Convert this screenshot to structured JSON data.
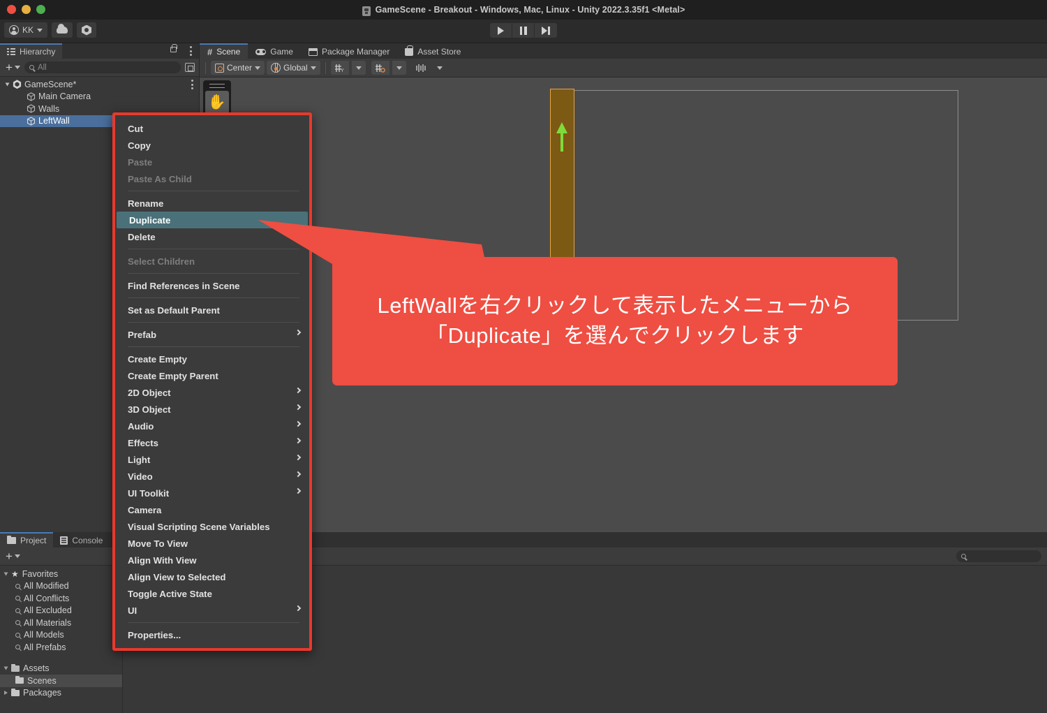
{
  "window": {
    "title": "GameScene - Breakout - Windows, Mac, Linux - Unity 2022.3.35f1 <Metal>",
    "app_icon": "unity-icon"
  },
  "toolbar": {
    "account_label": "KK",
    "cloud_icon": "cloud-icon",
    "settings_icon": "services-hex-icon",
    "play_icon": "play-icon",
    "pause_icon": "pause-icon",
    "step_icon": "step-icon"
  },
  "hierarchy": {
    "tab_label": "Hierarchy",
    "lock_icon": "lock-icon",
    "menu_icon": "kebab-menu-icon",
    "add_label": "+",
    "search_placeholder": "All",
    "search_value": "",
    "items": [
      {
        "label": "GameScene*",
        "icon": "unity-scene-icon",
        "indent": 0,
        "selected": false,
        "expanded": true
      },
      {
        "label": "Main Camera",
        "icon": "gameobject-cube-icon",
        "indent": 1,
        "selected": false
      },
      {
        "label": "Walls",
        "icon": "gameobject-cube-icon",
        "indent": 1,
        "selected": false
      },
      {
        "label": "LeftWall",
        "icon": "gameobject-cube-icon",
        "indent": 1,
        "selected": true
      }
    ]
  },
  "main_tabs": [
    {
      "label": "Scene",
      "icon": "scene-hash-icon",
      "active": true
    },
    {
      "label": "Game",
      "icon": "game-controller-icon",
      "active": false
    },
    {
      "label": "Package Manager",
      "icon": "package-icon",
      "active": false
    },
    {
      "label": "Asset Store",
      "icon": "store-bag-icon",
      "active": false
    }
  ],
  "scene_toolbar": {
    "pivot_label": "Center",
    "handle_label": "Global",
    "grid_icon": "grid-snap-icon",
    "snap_icon": "snap-increment-icon",
    "ruler_icon": "grid-ruler-icon"
  },
  "scene_view": {
    "hand_tool_icon": "hand-tool-icon",
    "selected_object": "LeftWall",
    "gizmo_arrow": "move-up-arrow-gizmo",
    "wall_color": "#7d5a14",
    "wall_outline_color": "#e8a33f",
    "gizmo_color": "#7fdb3a",
    "background_color": "#4b4b4b"
  },
  "context_menu": {
    "highlight_color": "#4a7179",
    "border_color": "#e8392c",
    "items": [
      {
        "label": "Cut",
        "enabled": true,
        "submenu": false
      },
      {
        "label": "Copy",
        "enabled": true,
        "submenu": false
      },
      {
        "label": "Paste",
        "enabled": false,
        "submenu": false
      },
      {
        "label": "Paste As Child",
        "enabled": false,
        "submenu": false
      },
      {
        "separator": true
      },
      {
        "label": "Rename",
        "enabled": true,
        "submenu": false
      },
      {
        "label": "Duplicate",
        "enabled": true,
        "submenu": false,
        "highlighted": true
      },
      {
        "label": "Delete",
        "enabled": true,
        "submenu": false
      },
      {
        "separator": true
      },
      {
        "label": "Select Children",
        "enabled": false,
        "submenu": false
      },
      {
        "separator": true
      },
      {
        "label": "Find References in Scene",
        "enabled": true,
        "submenu": false
      },
      {
        "separator": true
      },
      {
        "label": "Set as Default Parent",
        "enabled": true,
        "submenu": false
      },
      {
        "separator": true
      },
      {
        "label": "Prefab",
        "enabled": true,
        "submenu": true
      },
      {
        "separator": true
      },
      {
        "label": "Create Empty",
        "enabled": true,
        "submenu": false
      },
      {
        "label": "Create Empty Parent",
        "enabled": true,
        "submenu": false
      },
      {
        "label": "2D Object",
        "enabled": true,
        "submenu": true
      },
      {
        "label": "3D Object",
        "enabled": true,
        "submenu": true
      },
      {
        "label": "Audio",
        "enabled": true,
        "submenu": true
      },
      {
        "label": "Effects",
        "enabled": true,
        "submenu": true
      },
      {
        "label": "Light",
        "enabled": true,
        "submenu": true
      },
      {
        "label": "Video",
        "enabled": true,
        "submenu": true
      },
      {
        "label": "UI Toolkit",
        "enabled": true,
        "submenu": true
      },
      {
        "label": "Camera",
        "enabled": true,
        "submenu": false
      },
      {
        "label": "Visual Scripting Scene Variables",
        "enabled": true,
        "submenu": false
      },
      {
        "label": "Move To View",
        "enabled": true,
        "submenu": false
      },
      {
        "label": "Align With View",
        "enabled": true,
        "submenu": false
      },
      {
        "label": "Align View to Selected",
        "enabled": true,
        "submenu": false
      },
      {
        "label": "Toggle Active State",
        "enabled": true,
        "submenu": false
      },
      {
        "label": "UI",
        "enabled": true,
        "submenu": true
      },
      {
        "separator": true
      },
      {
        "label": "Properties...",
        "enabled": true,
        "submenu": false
      }
    ]
  },
  "annotation": {
    "line1": "LeftWallを右クリックして表示したメニューから",
    "line2": "「Duplicate」を選んでクリックします",
    "background_color": "#ef4e42",
    "text_color": "#ffffff"
  },
  "project_panel": {
    "tabs": [
      {
        "label": "Project",
        "icon": "folder-icon",
        "active": true
      },
      {
        "label": "Console",
        "icon": "console-icon",
        "active": false
      }
    ],
    "add_label": "+",
    "search_placeholder": "",
    "search_value": "",
    "tree": [
      {
        "label": "Favorites",
        "icon": "star-icon",
        "indent": 0,
        "expanded": true
      },
      {
        "label": "All Modified",
        "icon": "search-icon",
        "indent": 1
      },
      {
        "label": "All Conflicts",
        "icon": "search-icon",
        "indent": 1
      },
      {
        "label": "All Excluded",
        "icon": "search-icon",
        "indent": 1
      },
      {
        "label": "All Materials",
        "icon": "search-icon",
        "indent": 1
      },
      {
        "label": "All Models",
        "icon": "search-icon",
        "indent": 1
      },
      {
        "label": "All Prefabs",
        "icon": "search-icon",
        "indent": 1
      },
      {
        "label": "Assets",
        "icon": "folder-open-icon",
        "indent": 0,
        "expanded": true
      },
      {
        "label": "Scenes",
        "icon": "folder-icon",
        "indent": 1,
        "selected": true
      },
      {
        "label": "Packages",
        "icon": "folder-icon",
        "indent": 0,
        "expanded": false
      }
    ]
  }
}
